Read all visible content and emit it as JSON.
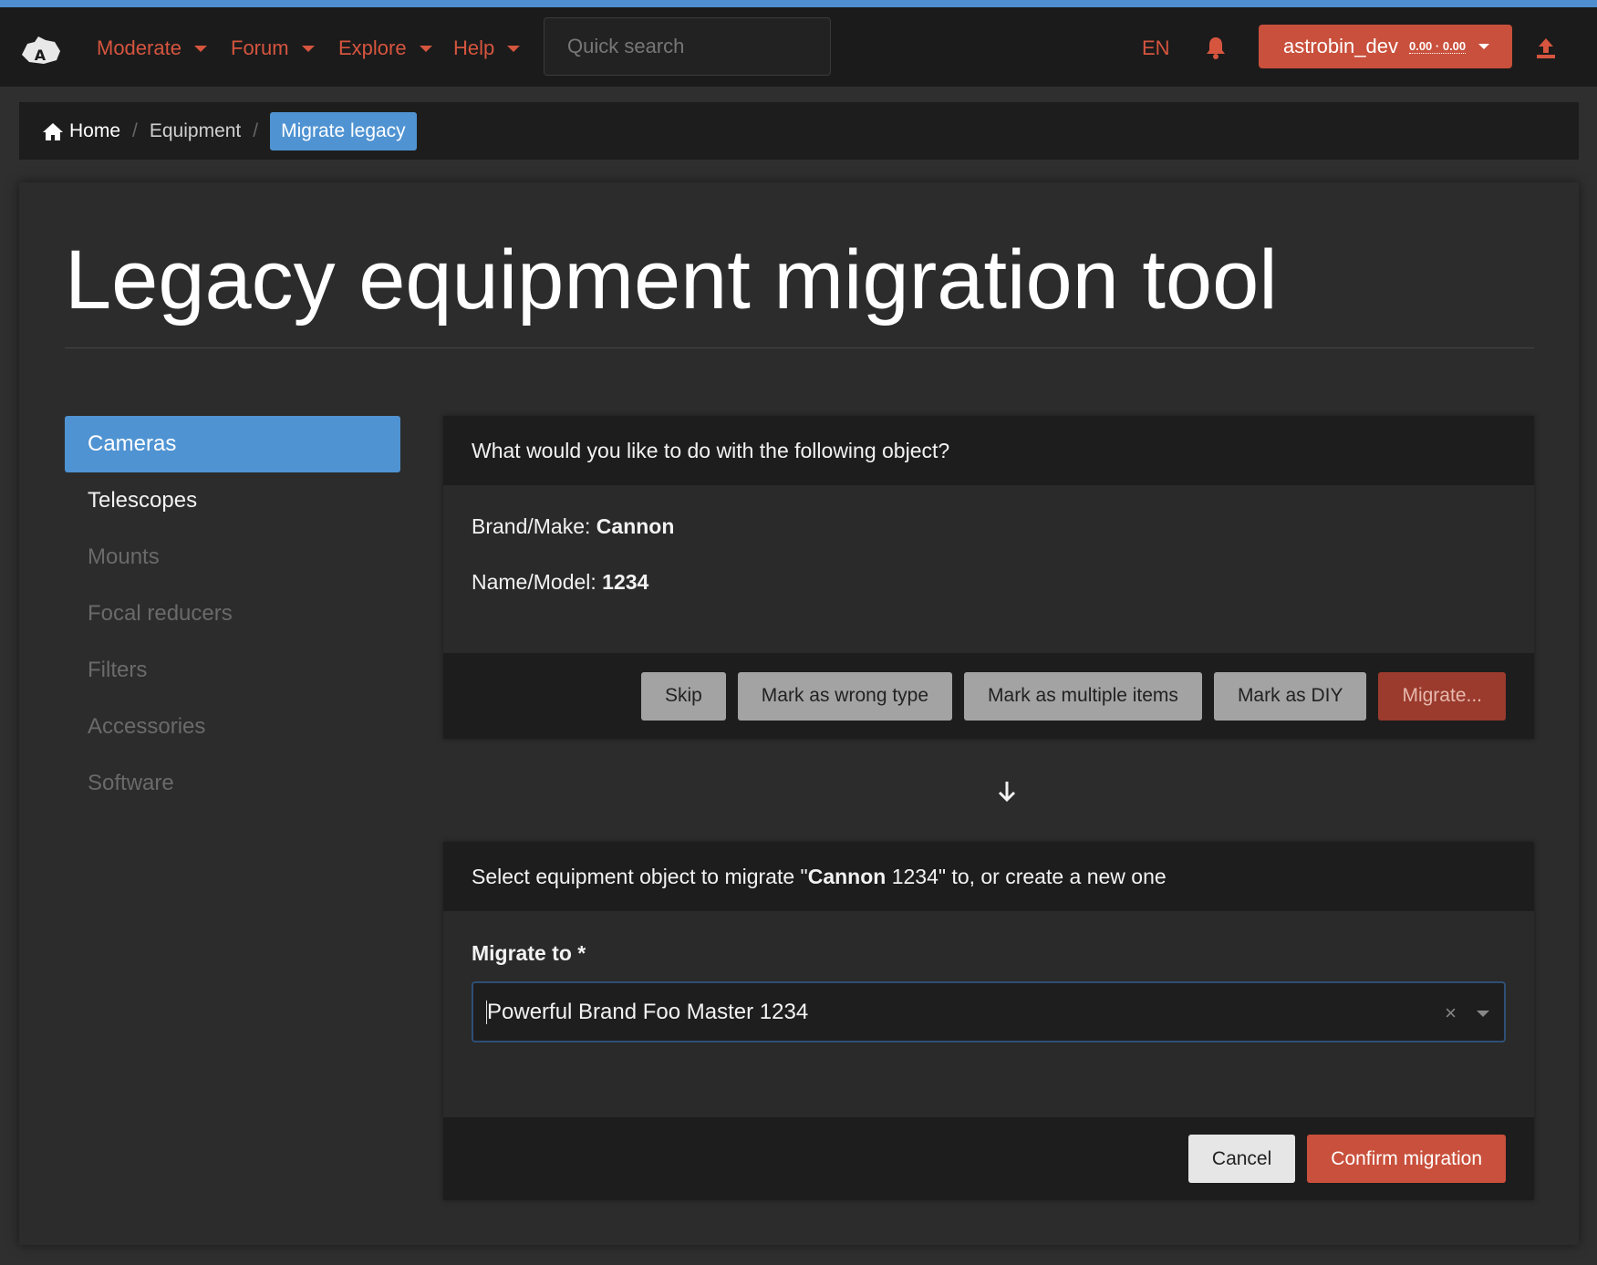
{
  "colors": {
    "accent_blue": "#4f93d2",
    "accent_red": "#c9503c",
    "nav_text": "#d6553f",
    "background": "#2f2f2f",
    "navbar": "#1b1b1b"
  },
  "navbar": {
    "logo_icon": "astrobin-logo-icon",
    "menu": [
      {
        "label": "Moderate"
      },
      {
        "label": "Forum"
      },
      {
        "label": "Explore"
      },
      {
        "label": "Help"
      }
    ],
    "search_placeholder": "Quick search",
    "language": "EN",
    "notifications_icon": "bell-icon",
    "user": {
      "name": "astrobin_dev",
      "stats": "0.00 · 0.00"
    },
    "upload_icon": "upload-icon"
  },
  "breadcrumb": {
    "home": "Home",
    "equipment": "Equipment",
    "current": "Migrate legacy"
  },
  "page": {
    "title": "Legacy equipment migration tool"
  },
  "sidenav": [
    {
      "label": "Cameras",
      "state": "active"
    },
    {
      "label": "Telescopes",
      "state": "enabled"
    },
    {
      "label": "Mounts",
      "state": "disabled"
    },
    {
      "label": "Focal reducers",
      "state": "disabled"
    },
    {
      "label": "Filters",
      "state": "disabled"
    },
    {
      "label": "Accessories",
      "state": "disabled"
    },
    {
      "label": "Software",
      "state": "disabled"
    }
  ],
  "object_card": {
    "header": "What would you like to do with the following object?",
    "brand_label": "Brand/Make:",
    "brand_value": "Cannon",
    "name_label": "Name/Model:",
    "name_value": "1234",
    "buttons": {
      "skip": "Skip",
      "wrong_type": "Mark as wrong type",
      "multiple": "Mark as multiple items",
      "diy": "Mark as DIY",
      "migrate": "Migrate..."
    }
  },
  "migrate_card": {
    "header_prefix": "Select equipment object to migrate \"",
    "header_brand": "Cannon",
    "header_model": " 1234",
    "header_suffix": "\" to, or create a new one",
    "field_label": "Migrate to *",
    "selected_value": "Powerful Brand Foo Master 1234",
    "clear_symbol": "×",
    "buttons": {
      "cancel": "Cancel",
      "confirm": "Confirm migration"
    }
  }
}
